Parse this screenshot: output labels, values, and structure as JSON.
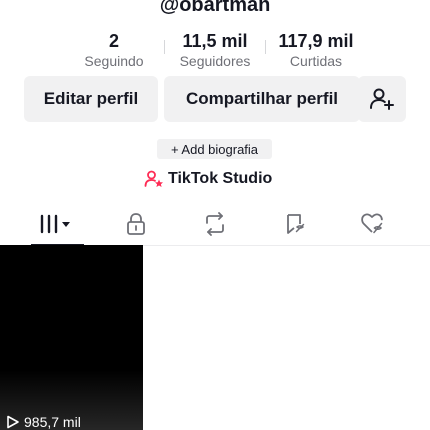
{
  "profile": {
    "username": "@obartman"
  },
  "stats": {
    "following": {
      "value": "2",
      "label": "Seguindo"
    },
    "followers": {
      "value": "11,5 mil",
      "label": "Seguidores"
    },
    "likes": {
      "value": "117,9 mil",
      "label": "Curtidas"
    }
  },
  "actions": {
    "edit_label": "Editar perfil",
    "share_label": "Compartilhar perfil",
    "add_friend_icon": "person-plus-icon"
  },
  "bio": {
    "add_label": "+ Add biografia"
  },
  "studio": {
    "label": "TikTok Studio",
    "icon": "person-star-icon",
    "accent_color": "#fe2c55"
  },
  "tabs": [
    {
      "name": "videos",
      "icon": "grid-bars-icon",
      "active": true
    },
    {
      "name": "private",
      "icon": "lock-icon",
      "active": false
    },
    {
      "name": "reposts",
      "icon": "repost-icon",
      "active": false
    },
    {
      "name": "favorites",
      "icon": "bookmark-icon",
      "active": false
    },
    {
      "name": "liked",
      "icon": "heart-hidden-icon",
      "active": false
    }
  ],
  "videos": [
    {
      "views": "985,7 mil"
    }
  ]
}
